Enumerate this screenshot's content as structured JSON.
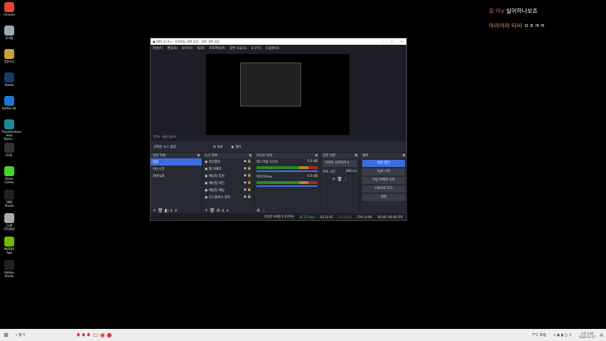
{
  "desktop": {
    "icons": [
      {
        "label": "Chrome",
        "color": "#e8453c"
      },
      {
        "label": "휴지통",
        "color": "#9ab"
      },
      {
        "label": "업동이니",
        "color": "#c9a13a"
      },
      {
        "label": "Steam",
        "color": "#1b3a6b"
      },
      {
        "label": "Battle.net",
        "color": "#1e76d4"
      },
      {
        "label": "Thunderstone Host Mana...",
        "color": "#1b8a9a"
      },
      {
        "label": "ICUE",
        "color": "#333"
      },
      {
        "label": "Razer Cortex",
        "color": "#44d62c"
      },
      {
        "label": "OBS Studio",
        "color": "#222"
      },
      {
        "label": "CLIP STUDIO",
        "color": "#aaa"
      },
      {
        "label": "NVIDIA App",
        "color": "#76b900"
      },
      {
        "label": "Roblox Studio",
        "color": "#222"
      }
    ]
  },
  "chat": [
    {
      "name": "호 아y",
      "msg": "싫어하나보죠"
    },
    {
      "name": "아라아라 타비",
      "msg": "ㅇㅈㅋㅋ"
    }
  ],
  "obs": {
    "title": "OBS 32.0.x - 프로파일: 제목 없음 - 장면: 제목 없음",
    "menu": [
      "파일(F)",
      "편집(E)",
      "보기(V)",
      "독(D)",
      "프로파일(P)",
      "장면 모음(S)",
      "도구(T)",
      "도움말(H)"
    ],
    "zoom": "37%",
    "fit": "화면 맞추기",
    "context": {
      "none": "선택된 소스 없음",
      "props": "속성",
      "filters": "필터"
    },
    "scenes": {
      "title": "장면 목록",
      "items": [
        "방송",
        "쉬는시간",
        "화면녹화"
      ]
    },
    "sources": {
      "title": "소스 목록",
      "items": [
        "영상캡처",
        "웹 카메라",
        "채팅창 후원",
        "채팅창 대전",
        "채팅창 채팅",
        "디스플레이 캡처"
      ]
    },
    "audio": {
      "title": "오디오 믹서",
      "channels": [
        {
          "name": "데스크탑 오디오",
          "db": "0.0 dB"
        },
        {
          "name": "마이크/Aux",
          "db": "0.0 dB"
        }
      ]
    },
    "transitions": {
      "title": "장면 전환",
      "selected": "서서히 사라지기",
      "duration_label": "지속 시간",
      "duration": "300 ms"
    },
    "controls": {
      "title": "제어",
      "buttons": [
        "방송 중단",
        "녹화 시작",
        "가상 카메라 시작",
        "스튜디오 모드",
        "설정"
      ]
    },
    "status": {
      "dropped": "손실된 프레임 0 (0.0%)",
      "bitrate": "8173 kbps",
      "live": "02:12:07",
      "rec": "00:00:00",
      "cpu": "CPU: 0.9%",
      "fps": "60.00 / 60.00 FPS"
    }
  },
  "taskbar": {
    "search": "찾기",
    "weather": "7°C 흐림",
    "time": "오후 1:40",
    "date": "2025-12-17"
  }
}
